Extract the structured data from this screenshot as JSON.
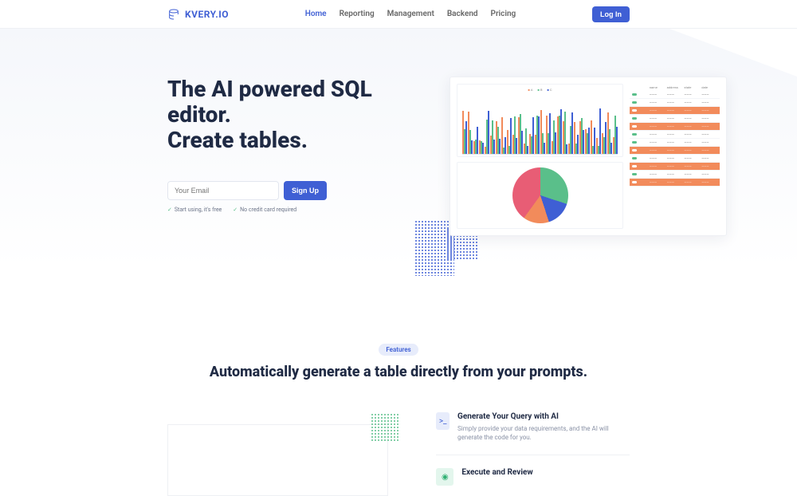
{
  "brand": "KVERY.IO",
  "nav": {
    "home": "Home",
    "reporting": "Reporting",
    "management": "Management",
    "backend": "Backend",
    "pricing": "Pricing"
  },
  "login_label": "Log In",
  "hero": {
    "line1_prefix": "The ",
    "line1_ai": "AI",
    "line1_suffix": " powered SQL",
    "line2": "editor.",
    "line3": "Create tables.",
    "email_placeholder": "Your Email",
    "signup_label": "Sign Up",
    "benefit1": "Start using, it's free",
    "benefit2": "No credit card required"
  },
  "features": {
    "badge": "Features",
    "title": "Automatically generate a table directly from your prompts.",
    "item1_title": "Generate Your Query with AI",
    "item1_desc": "Simply provide your data requirements, and the AI will generate the code for you.",
    "item2_title": "Execute and Review"
  }
}
